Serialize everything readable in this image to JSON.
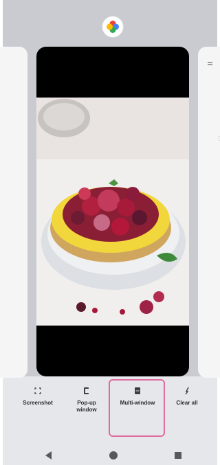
{
  "recents": {
    "app_icon": "google-photos-icon",
    "center_card_content": "food-photo-berry-tart"
  },
  "actions": [
    {
      "label": "Screenshot",
      "icon": "screenshot-icon"
    },
    {
      "label": "Pop-up window",
      "icon": "popup-window-icon"
    },
    {
      "label": "Multi-window",
      "icon": "multi-window-icon",
      "selected": true
    },
    {
      "label": "Clear all",
      "icon": "clear-all-icon"
    }
  ],
  "highlight_color": "#e06aa2",
  "navbar": {
    "back": "back-icon",
    "home": "home-icon",
    "recents": "recents-icon"
  }
}
